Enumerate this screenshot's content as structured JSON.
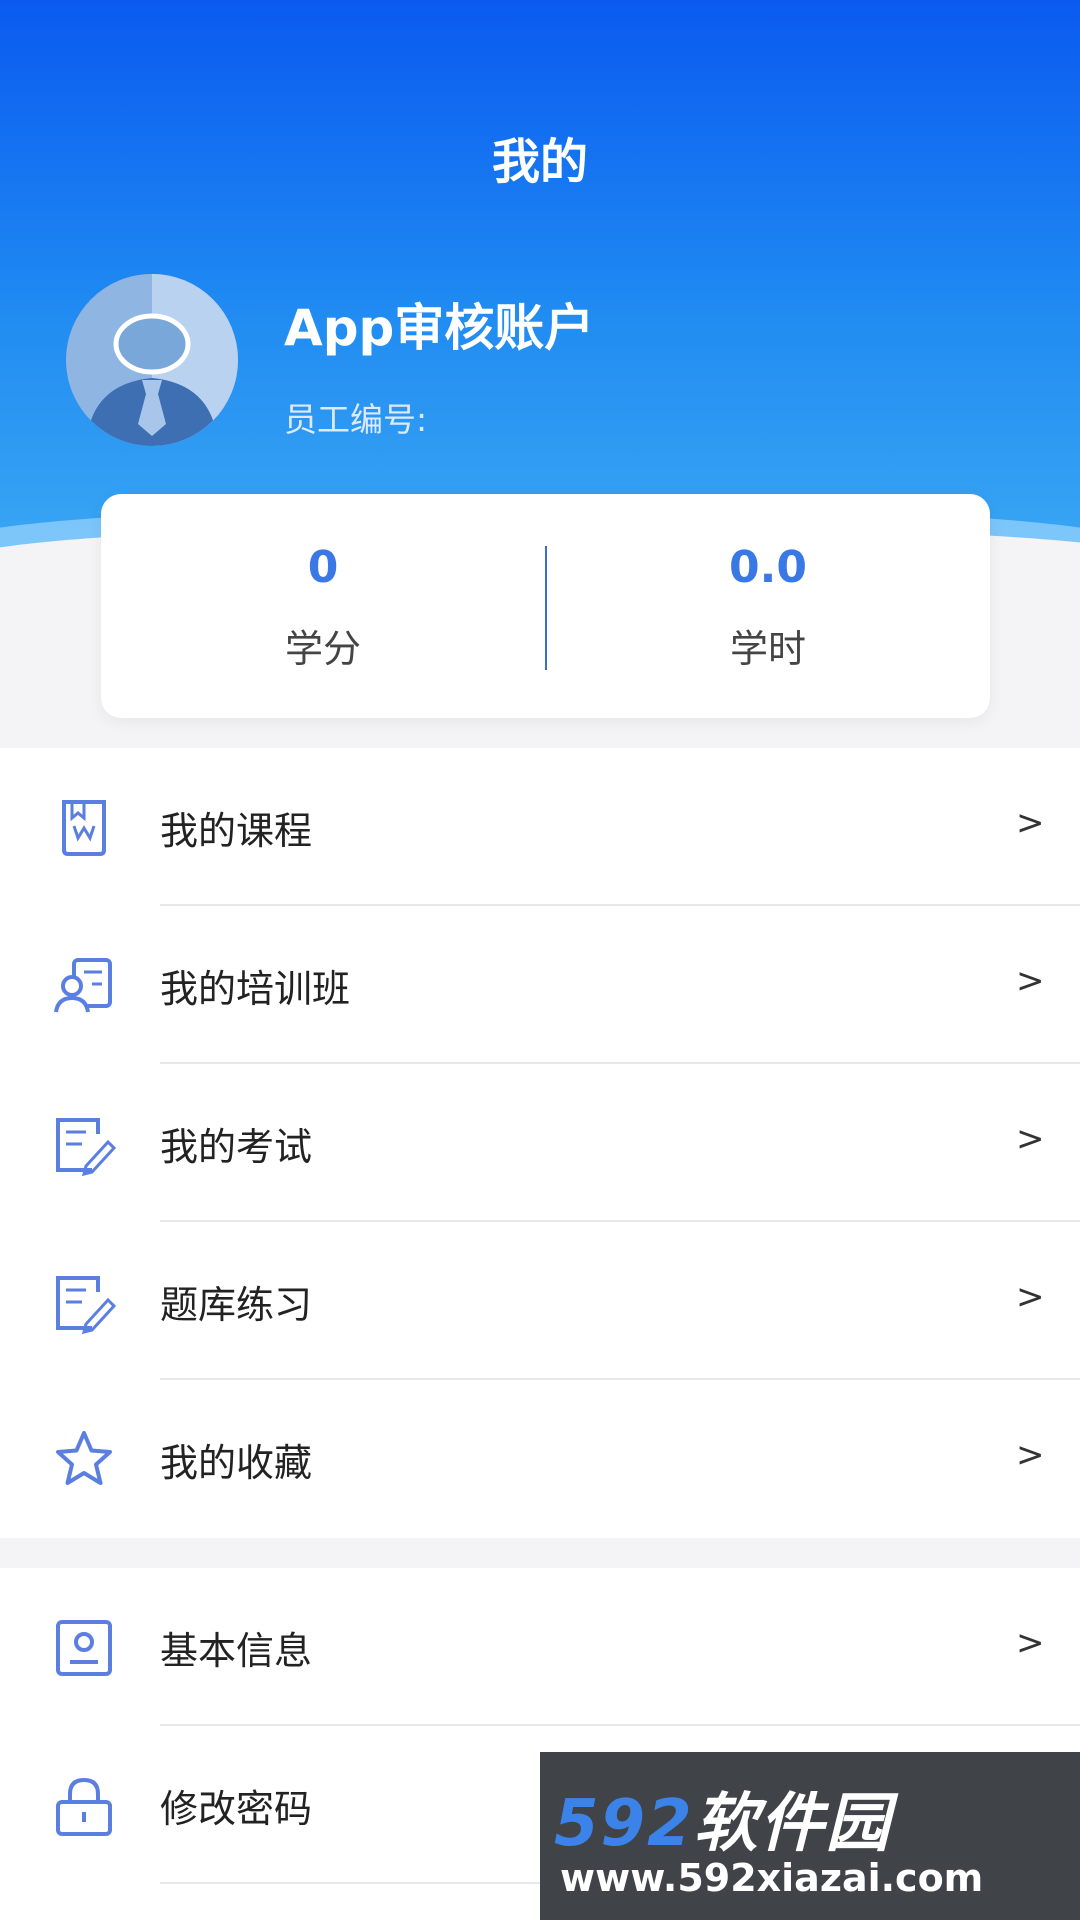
{
  "header": {
    "title": "我的"
  },
  "profile": {
    "name": "App审核账户",
    "employee_id_label": "员工编号:"
  },
  "stats": [
    {
      "value": "0",
      "label": "学分"
    },
    {
      "value": "0.0",
      "label": "学时"
    }
  ],
  "menu_group_1": [
    {
      "label": "我的课程",
      "icon": "course-book-icon",
      "arrow": ">"
    },
    {
      "label": "我的培训班",
      "icon": "training-class-icon",
      "arrow": ">"
    },
    {
      "label": "我的考试",
      "icon": "exam-edit-icon",
      "arrow": ">"
    },
    {
      "label": "题库练习",
      "icon": "practice-edit-icon",
      "arrow": ">"
    },
    {
      "label": "我的收藏",
      "icon": "star-icon",
      "arrow": ">"
    }
  ],
  "menu_group_2": [
    {
      "label": "基本信息",
      "icon": "profile-card-icon",
      "arrow": ">"
    },
    {
      "label": "修改密码",
      "icon": "lock-icon",
      "arrow": ">"
    }
  ],
  "watermark": {
    "brand_number": "592",
    "brand_text": "软件园",
    "url": "www.592xiazai.com"
  },
  "colors": {
    "header_top": "#0a5af0",
    "header_bottom": "#3aa6f3",
    "accent": "#3a78e6",
    "icon": "#5b7fe0"
  }
}
